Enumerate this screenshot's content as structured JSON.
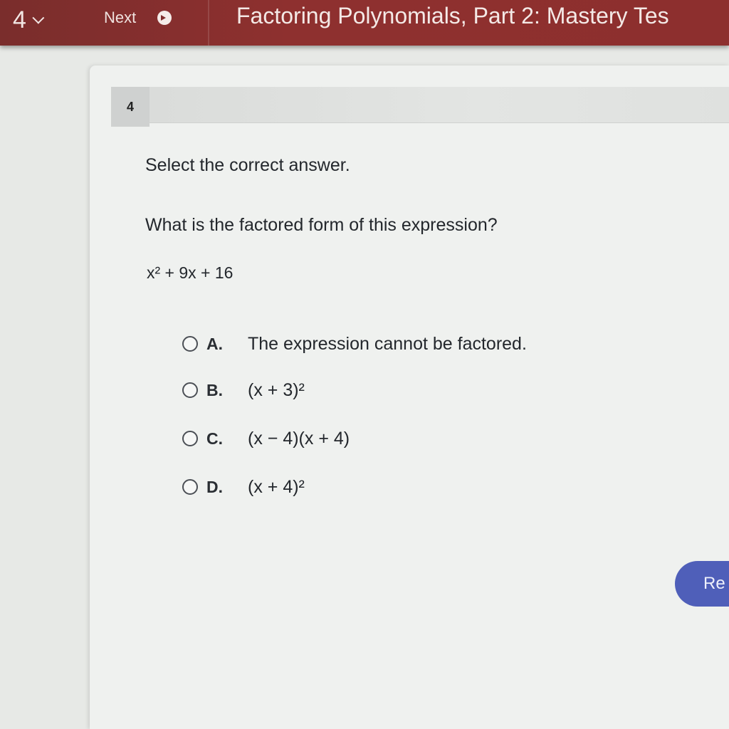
{
  "topbar": {
    "question_number": "4",
    "next_label": "Next",
    "test_title": "Factoring Polynomials, Part 2: Mastery Tes"
  },
  "question": {
    "number_badge": "4",
    "instruction": "Select the correct answer.",
    "prompt": "What is the factored form of this expression?",
    "expression": "x² + 9x + 16",
    "options": [
      {
        "letter": "A.",
        "text": "The expression cannot be factored."
      },
      {
        "letter": "B.",
        "text": "(x + 3)²"
      },
      {
        "letter": "C.",
        "text": "(x − 4)(x + 4)"
      },
      {
        "letter": "D.",
        "text": "(x + 4)²"
      }
    ]
  },
  "actions": {
    "reset_label": "Re"
  },
  "colors": {
    "topbar": "#8d2f2e",
    "card_background": "#eff1ef",
    "reset_button": "#4f5fb9"
  }
}
